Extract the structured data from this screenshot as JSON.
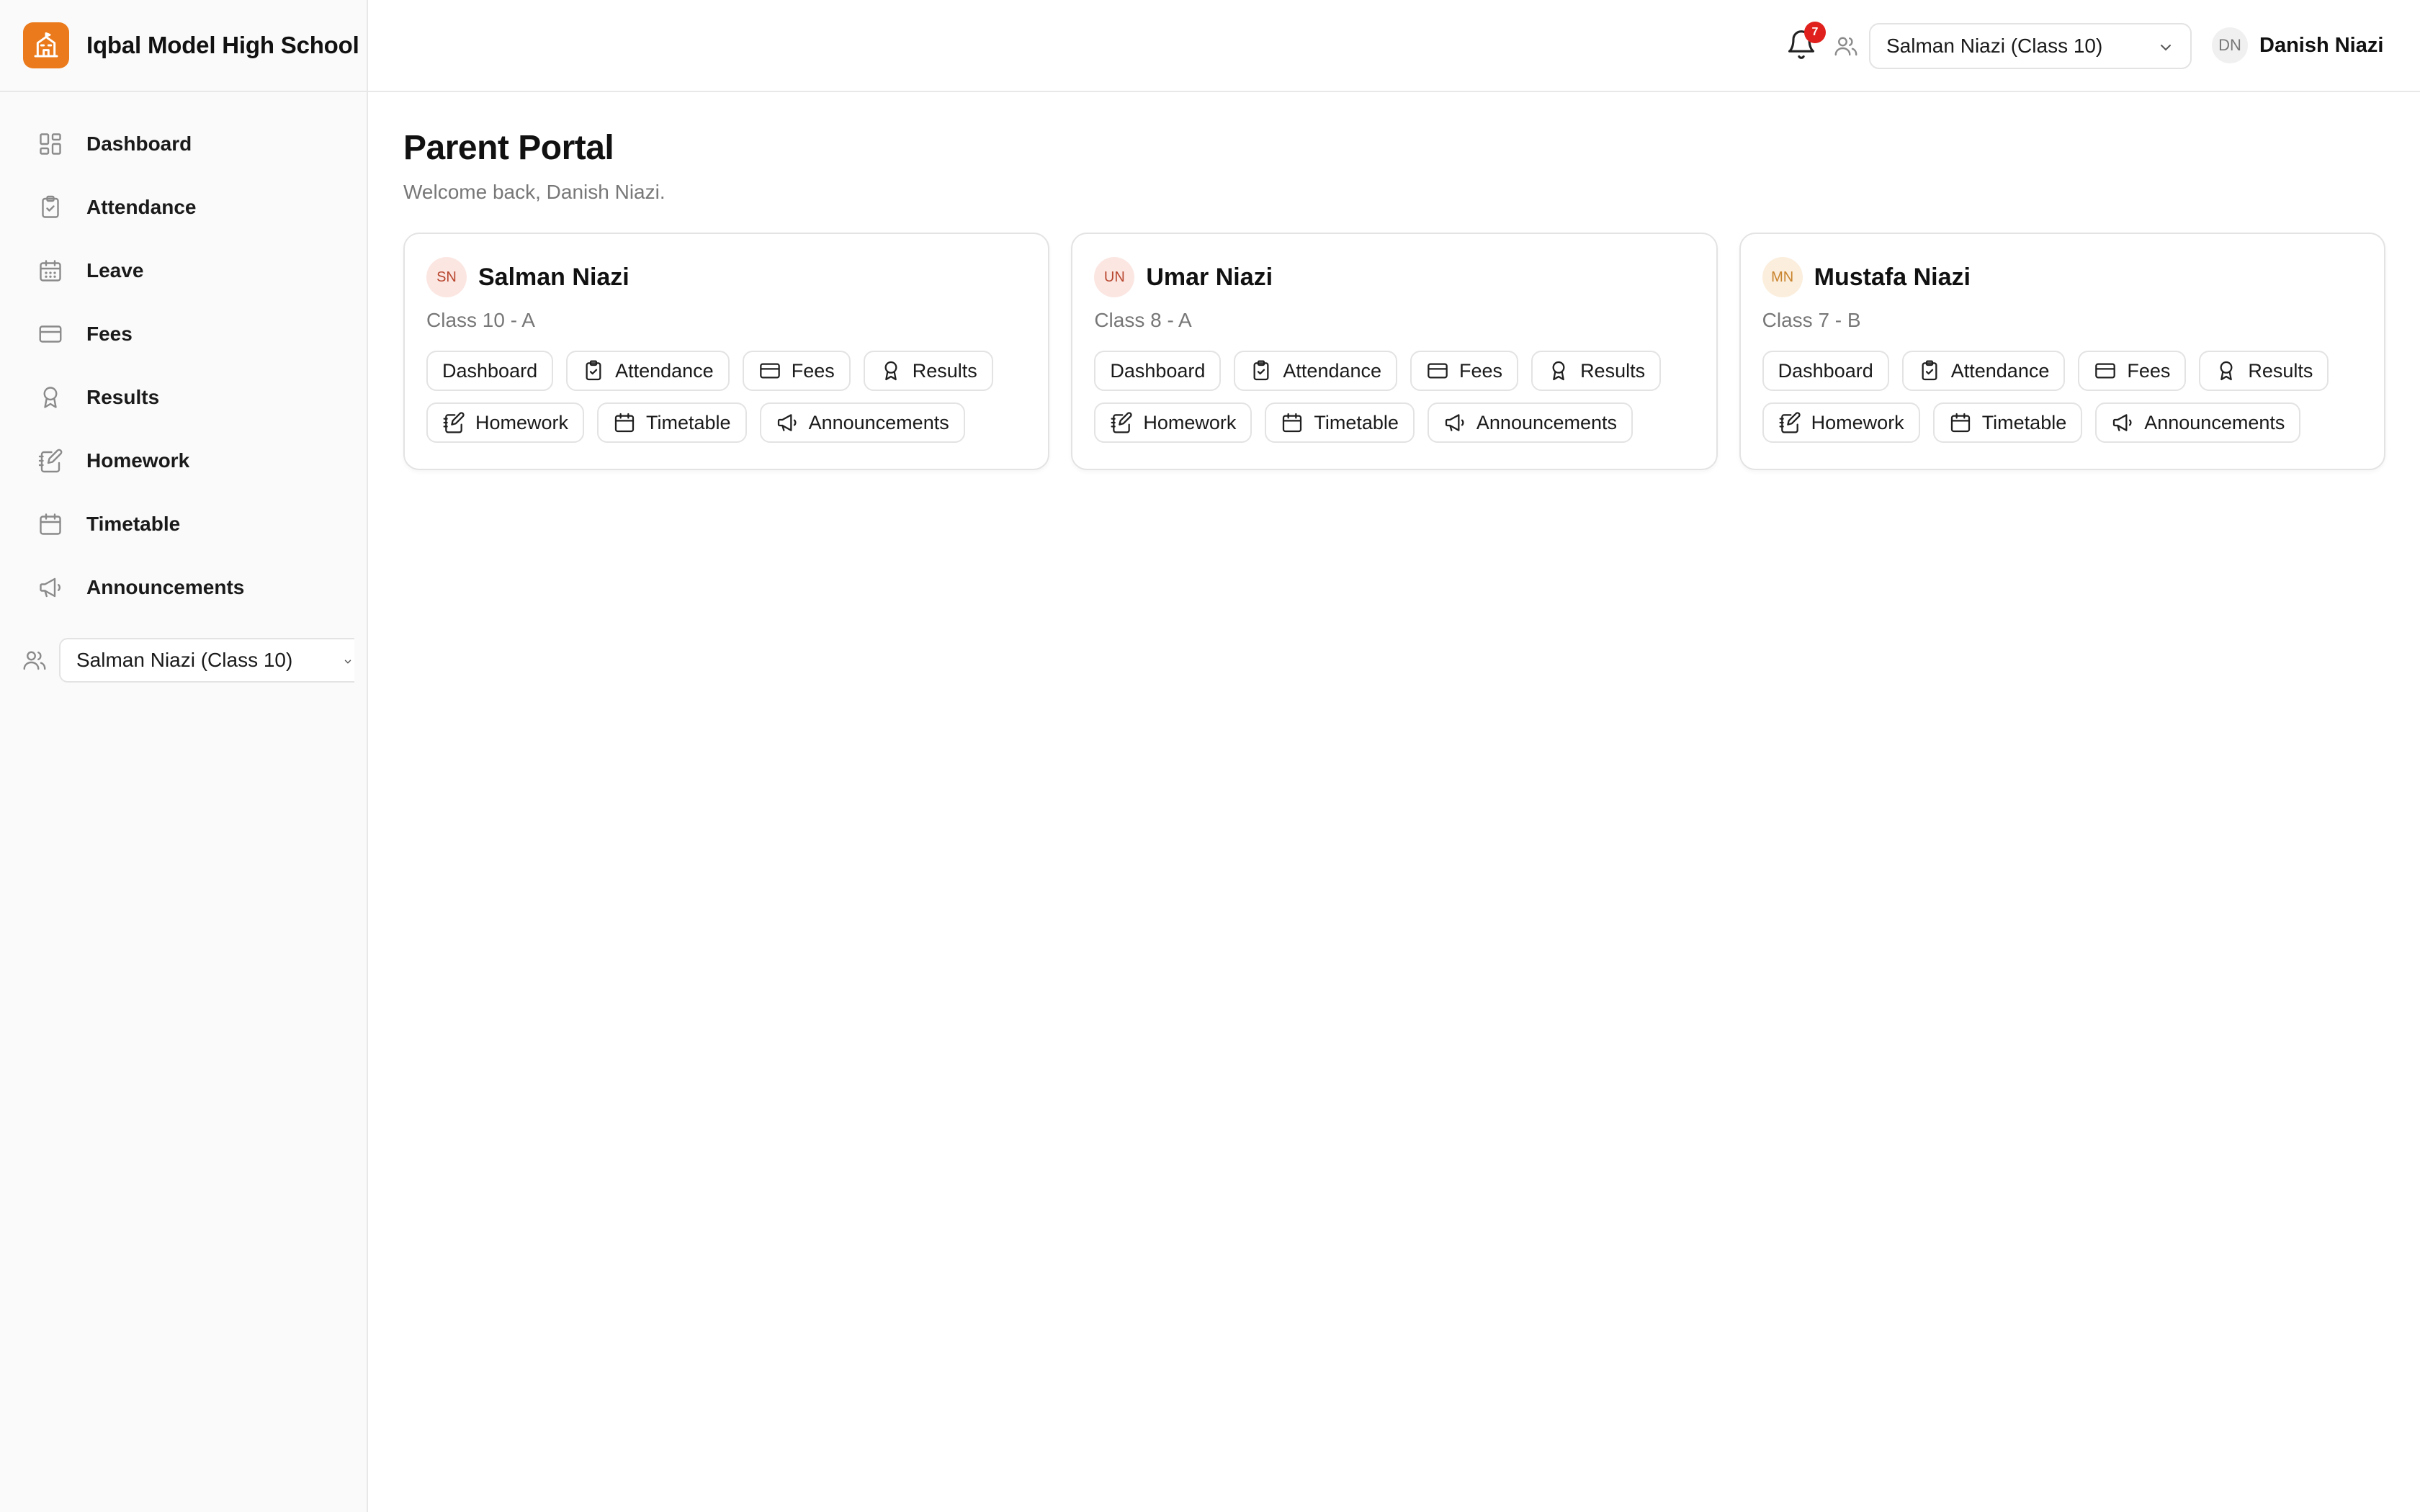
{
  "brand": {
    "name": "Iqbal Model High School",
    "logo_icon": "school-icon",
    "logo_color": "#ea7a1b"
  },
  "sidebar": {
    "items": [
      {
        "label": "Dashboard",
        "icon": "dashboard-icon"
      },
      {
        "label": "Attendance",
        "icon": "clipboard-check-icon"
      },
      {
        "label": "Leave",
        "icon": "calendar-dots-icon"
      },
      {
        "label": "Fees",
        "icon": "credit-card-icon"
      },
      {
        "label": "Results",
        "icon": "award-icon"
      },
      {
        "label": "Homework",
        "icon": "notebook-pen-icon"
      },
      {
        "label": "Timetable",
        "icon": "calendar-icon"
      },
      {
        "label": "Announcements",
        "icon": "megaphone-icon"
      }
    ],
    "child_select": {
      "value": "Salman Niazi (Class 10)"
    }
  },
  "header": {
    "notification_count": "7",
    "badge_color": "#e0201c",
    "child_select": {
      "value": "Salman Niazi (Class 10)"
    },
    "user": {
      "initials": "DN",
      "name": "Danish Niazi"
    }
  },
  "main": {
    "title": "Parent Portal",
    "subtitle": "Welcome back, Danish Niazi.",
    "children": [
      {
        "initials": "SN",
        "name": "Salman Niazi",
        "class": "Class 10 - A",
        "avatar_bg": "#fbe6e2",
        "avatar_fg": "#b8472f",
        "links": [
          {
            "label": "Dashboard",
            "icon": ""
          },
          {
            "label": "Attendance",
            "icon": "clipboard-check-icon"
          },
          {
            "label": "Fees",
            "icon": "credit-card-icon"
          },
          {
            "label": "Results",
            "icon": "award-icon"
          },
          {
            "label": "Homework",
            "icon": "notebook-pen-icon"
          },
          {
            "label": "Timetable",
            "icon": "calendar-icon"
          },
          {
            "label": "Announcements",
            "icon": "megaphone-icon"
          }
        ]
      },
      {
        "initials": "UN",
        "name": "Umar Niazi",
        "class": "Class 8 - A",
        "avatar_bg": "#fbe6e2",
        "avatar_fg": "#b8472f",
        "links": [
          {
            "label": "Dashboard",
            "icon": ""
          },
          {
            "label": "Attendance",
            "icon": "clipboard-check-icon"
          },
          {
            "label": "Fees",
            "icon": "credit-card-icon"
          },
          {
            "label": "Results",
            "icon": "award-icon"
          },
          {
            "label": "Homework",
            "icon": "notebook-pen-icon"
          },
          {
            "label": "Timetable",
            "icon": "calendar-icon"
          },
          {
            "label": "Announcements",
            "icon": "megaphone-icon"
          }
        ]
      },
      {
        "initials": "MN",
        "name": "Mustafa Niazi",
        "class": "Class 7 - B",
        "avatar_bg": "#fbeedd",
        "avatar_fg": "#c9842d",
        "links": [
          {
            "label": "Dashboard",
            "icon": ""
          },
          {
            "label": "Attendance",
            "icon": "clipboard-check-icon"
          },
          {
            "label": "Fees",
            "icon": "credit-card-icon"
          },
          {
            "label": "Results",
            "icon": "award-icon"
          },
          {
            "label": "Homework",
            "icon": "notebook-pen-icon"
          },
          {
            "label": "Timetable",
            "icon": "calendar-icon"
          },
          {
            "label": "Announcements",
            "icon": "megaphone-icon"
          }
        ]
      }
    ]
  }
}
